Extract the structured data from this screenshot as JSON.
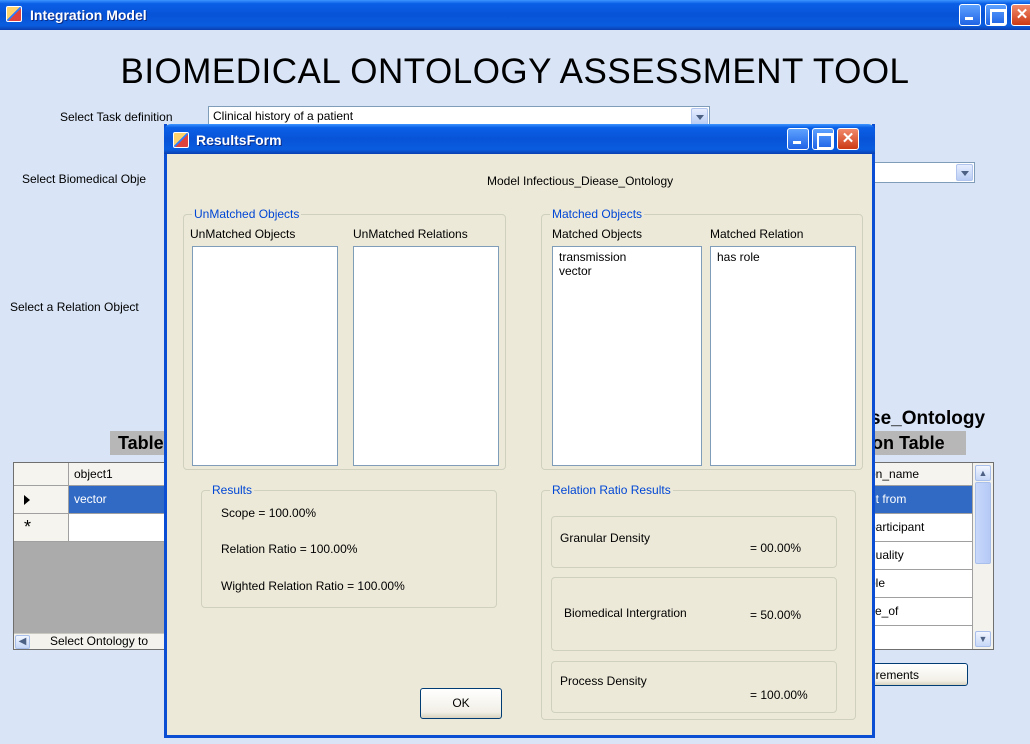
{
  "main_window": {
    "title": "Integration Model",
    "heading": "BIOMEDICAL ONTOLOGY ASSESSMENT TOOL",
    "task_label": "Select Task definition",
    "task_value": "Clinical history of a patient",
    "bio_label": "Select Biomedical Obje",
    "relation_label": "Select a Relation Object",
    "ontology_header_line1": "se_Ontology",
    "ontology_header_line2": "on Table",
    "left_table_header": "Table",
    "left_grid": {
      "column": "object1",
      "rows": [
        "vector",
        ""
      ],
      "new_row_marker": "*"
    },
    "right_grid": {
      "column": "on_name",
      "rows": [
        "nt from",
        "participant",
        "quality",
        "ole",
        "se_of"
      ]
    },
    "select_ontology_label": "Select Ontology to",
    "requirements_button": "irements"
  },
  "dialog": {
    "title": "ResultsForm",
    "model_label": "Model Infectious_Diease_Ontology",
    "unmatched_group": "UnMatched Objects",
    "unmatched_objects_col": "UnMatched Objects",
    "unmatched_relations_col": "UnMatched Relations",
    "matched_group": "Matched Objects",
    "matched_objects_col": "Matched Objects",
    "matched_relation_col": "Matched Relation",
    "matched_objects": [
      "transmission",
      "vector"
    ],
    "matched_relations": [
      "has role"
    ],
    "results_group": "Results",
    "scope": "Scope = 100.00%",
    "relation_ratio": "Relation Ratio = 100.00%",
    "weighted_ratio": "Wighted Relation Ratio = 100.00%",
    "ratio_group": "Relation Ratio Results",
    "granular_label": "Granular Density",
    "granular_value": "=  00.00%",
    "integration_label": "Biomedical Intergration",
    "integration_value": "=  50.00%",
    "process_label": "Process Density",
    "process_value": "=  100.00%",
    "ok_button": "OK"
  }
}
